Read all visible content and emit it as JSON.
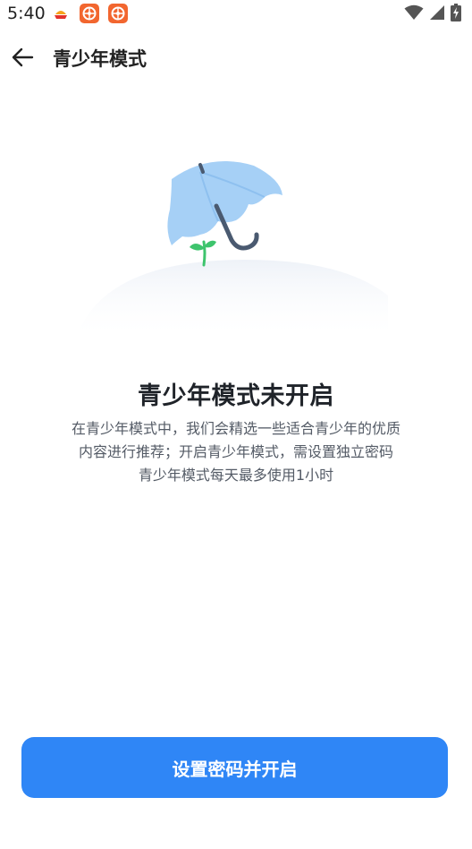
{
  "status_bar": {
    "time": "5:40",
    "icons": [
      "app-notification-icon",
      "app-notification-icon",
      "app-notification-icon",
      "wifi-icon",
      "signal-icon",
      "battery-charging-icon"
    ]
  },
  "header": {
    "back_icon": "arrow-left-icon",
    "title": "青少年模式"
  },
  "illustration": {
    "icon": "umbrella-sprout-illustration"
  },
  "main": {
    "title": "青少年模式未开启",
    "description_lines": [
      "在青少年模式中，我们会精选一些适合青少年的优质",
      "内容进行推荐；开启青少年模式，需设置独立密码",
      "青少年模式每天最多使用1小时"
    ]
  },
  "footer": {
    "primary_button_label": "设置密码并开启"
  },
  "colors": {
    "primary": "#2f86f6",
    "title": "#1f2329",
    "text": "#545b66",
    "umbrella": "#a6d0f6",
    "sprout": "#3ec46d"
  }
}
